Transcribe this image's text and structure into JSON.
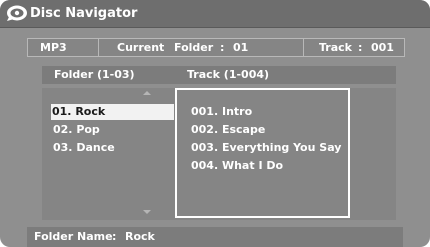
{
  "titlebar": {
    "title": "Disc Navigator",
    "icon": "disc-navigator-icon"
  },
  "status": {
    "format": "MP3",
    "current_label": "Current",
    "folder_label": "Folder",
    "folder_colon": ":",
    "folder_value": "01",
    "track_label": "Track",
    "track_colon": ":",
    "track_value": "001"
  },
  "columns": {
    "folder_header": "Folder (1-03)",
    "track_header": "Track (1-004)"
  },
  "folders": [
    {
      "label": "01. Rock",
      "selected": true
    },
    {
      "label": "02. Pop",
      "selected": false
    },
    {
      "label": "03. Dance",
      "selected": false
    }
  ],
  "tracks": [
    {
      "label": "001. Intro"
    },
    {
      "label": "002. Escape"
    },
    {
      "label": "003. Everything You Say"
    },
    {
      "label": "004. What I Do"
    }
  ],
  "footer": {
    "label": "Folder Name",
    "colon": ":",
    "value": "Rock"
  },
  "colors": {
    "background": "#8f8f8f",
    "selection": "#f2f2f2",
    "text": "#ffffff"
  }
}
